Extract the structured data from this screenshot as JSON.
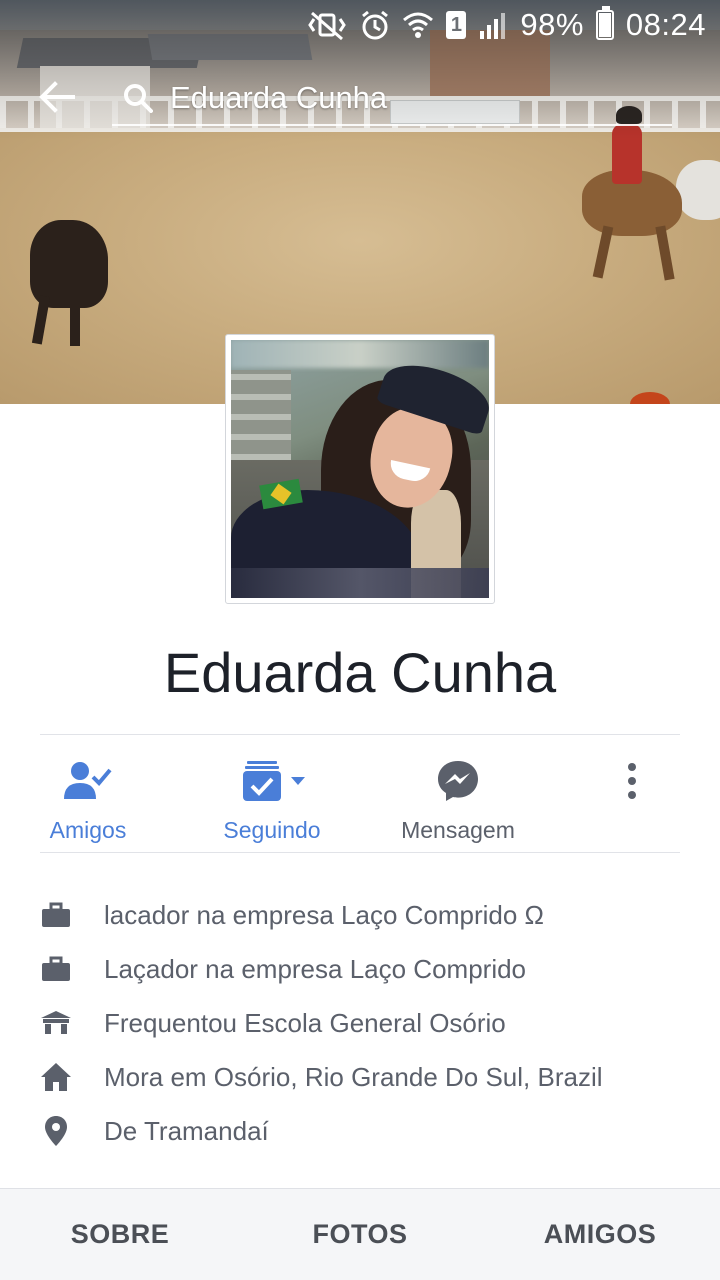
{
  "status_bar": {
    "battery": "98%",
    "time": "08:24",
    "sim_slot": "1",
    "battery_level": 0.98
  },
  "search": {
    "query": "Eduarda Cunha"
  },
  "profile": {
    "name": "Eduarda Cunha"
  },
  "actions": {
    "friends_label": "Amigos",
    "following_label": "Seguindo",
    "message_label": "Mensagem"
  },
  "about": {
    "items": [
      {
        "icon": "briefcase-icon",
        "text": "lacador na empresa Laço Comprido Ω"
      },
      {
        "icon": "briefcase-icon",
        "text": "Laçador na empresa Laço Comprido"
      },
      {
        "icon": "school-icon",
        "text": "Frequentou Escola General Osório"
      },
      {
        "icon": "home-icon",
        "text": "Mora em Osório, Rio Grande Do Sul, Brazil"
      },
      {
        "icon": "location-pin-icon",
        "text": "De Tramandaí"
      }
    ]
  },
  "tabs": {
    "about": "SOBRE",
    "photos": "FOTOS",
    "friends": "AMIGOS"
  },
  "colors": {
    "accent": "#4a7ed8",
    "text_primary": "#1d2129",
    "text_secondary": "#5b606b"
  }
}
